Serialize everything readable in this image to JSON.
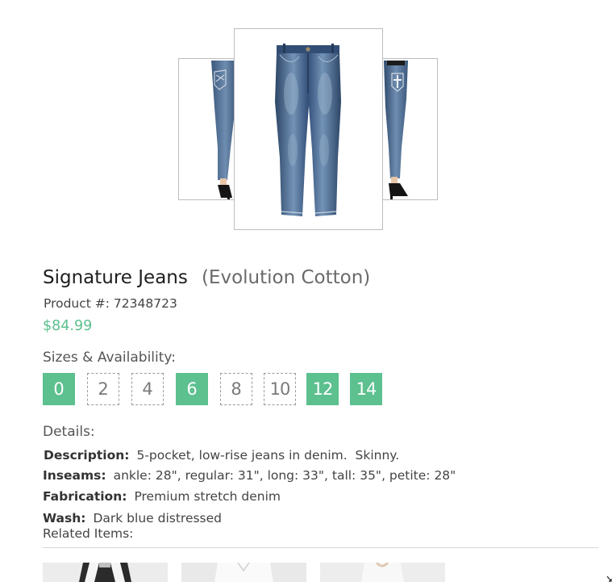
{
  "product": {
    "name": "Signature Jeans",
    "collection": "(Evolution Cotton)",
    "product_number": "Product #: 72348723",
    "price": "$84.99"
  },
  "gallery": {
    "images": [
      {
        "view": "back-left",
        "icon": "jeans-back-view-image"
      },
      {
        "view": "front",
        "icon": "jeans-front-view-image"
      },
      {
        "view": "back-right",
        "icon": "jeans-back-view-image"
      }
    ],
    "selected_index": 1
  },
  "sizes": {
    "heading": "Sizes & Availability:",
    "items": [
      {
        "label": "0",
        "available": true
      },
      {
        "label": "2",
        "available": false
      },
      {
        "label": "4",
        "available": false
      },
      {
        "label": "6",
        "available": true
      },
      {
        "label": "8",
        "available": false
      },
      {
        "label": "10",
        "available": false
      },
      {
        "label": "12",
        "available": true
      },
      {
        "label": "14",
        "available": true
      }
    ]
  },
  "details": {
    "heading": "Details:",
    "description_label": "Description:",
    "description_value": "5-pocket, low-rise jeans in denim.  Skinny.",
    "inseams_label": "Inseams:",
    "inseams_value": "ankle: 28\", regular: 31\", long: 33\", tall: 35\", petite: 28\"",
    "fabrication_label": "Fabrication:",
    "fabrication_value": "Premium stretch denim",
    "wash_label": "Wash:",
    "wash_value": "Dark blue distressed"
  },
  "related": {
    "heading": "Related Items:",
    "items": [
      {
        "icon": "related-item-striped-image"
      },
      {
        "icon": "related-item-white-shirt-image"
      },
      {
        "icon": "related-item-light-image"
      }
    ]
  },
  "colors": {
    "accent_green": "#5cc08f",
    "denim_dark": "#2c4566",
    "denim_light": "#5f7fa3"
  }
}
